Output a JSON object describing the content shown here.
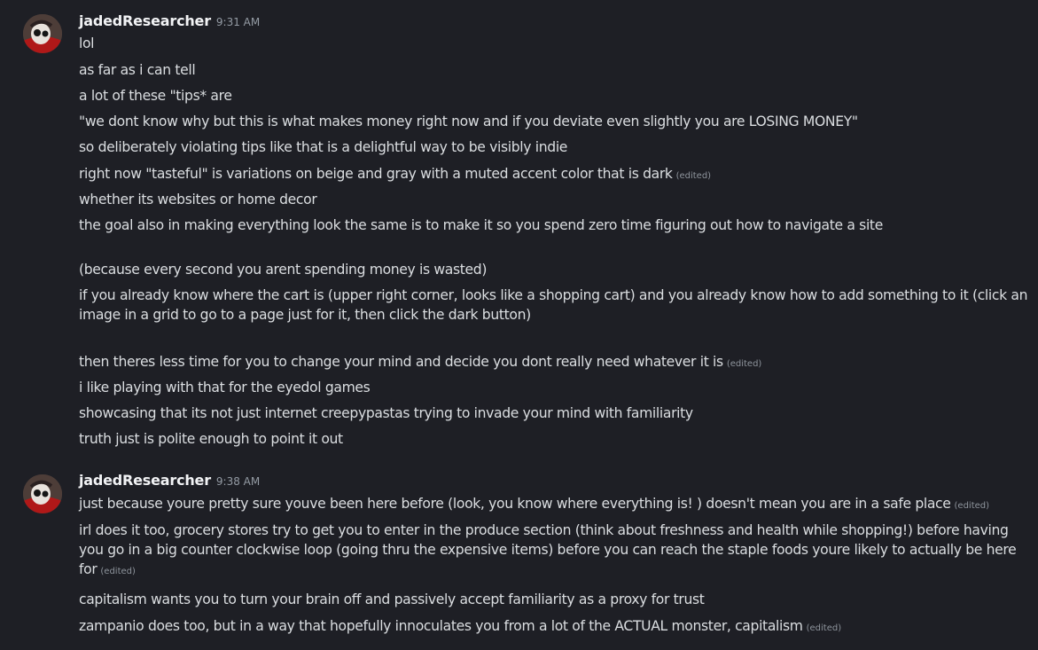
{
  "groups": [
    {
      "username": "jadedResearcher",
      "timestamp": "9:31 AM",
      "messages": [
        {
          "text": "lol",
          "edited": ""
        },
        {
          "text": "as far as i can tell",
          "edited": ""
        },
        {
          "text": "a lot of these \"tips* are",
          "edited": ""
        },
        {
          "text": "\"we dont know why but this is what makes money right now and if you deviate even slightly you are LOSING MONEY\"",
          "edited": ""
        },
        {
          "text": "so deliberately violating tips like that is a delightful way to be visibly indie",
          "edited": ""
        },
        {
          "text": "right now \"tasteful\" is variations on beige and gray with a muted accent color that is dark",
          "edited": "(edited)"
        },
        {
          "text": "whether its websites or home decor",
          "edited": ""
        },
        {
          "text": "the goal also in making everything look the same is to make it so you spend zero time figuring out how to navigate a site",
          "edited": ""
        },
        {
          "text": "(because every second you arent spending money is wasted)",
          "edited": ""
        },
        {
          "text": "if you already know where the cart is (upper right corner, looks like a shopping cart) and you already know how to add something to it (click an image in a grid to go to a page just for it, then click the dark  button)",
          "edited": ""
        },
        {
          "text": "then theres less time for you to change your mind and decide you dont really need whatever it is",
          "edited": "(edited)"
        },
        {
          "text": "i like playing with that for the eyedol games",
          "edited": ""
        },
        {
          "text": "showcasing that its not just internet creepypastas trying to invade your mind with familiarity",
          "edited": ""
        },
        {
          "text": "truth just is polite enough to point it out",
          "edited": ""
        }
      ]
    },
    {
      "username": "jadedResearcher",
      "timestamp": "9:38 AM",
      "messages": [
        {
          "text": "just because youre pretty sure youve been here before (look, you know where everything is! ) doesn't mean you are in a safe place",
          "edited": "(edited)"
        },
        {
          "text": "irl does it too, grocery stores try to get you to enter in the produce section (think about freshness and health while shopping!) before having you go in a big counter clockwise loop (going thru the expensive items) before you can reach the staple foods youre likely to actually be here for",
          "edited": "(edited)"
        },
        {
          "text": "capitalism wants you to turn your brain off and passively accept familiarity as a proxy for trust",
          "edited": ""
        },
        {
          "text": "zampanio does too, but in a way that hopefully innoculates you from a lot of the ACTUAL monster, capitalism",
          "edited": "(edited)"
        }
      ]
    }
  ]
}
